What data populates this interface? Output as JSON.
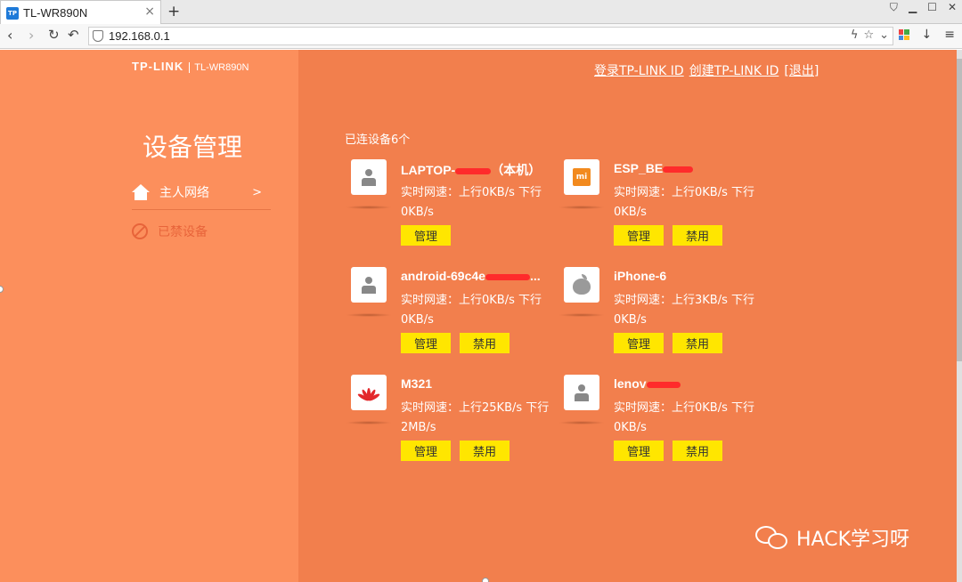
{
  "browser": {
    "tab_title": "TL-WR890N",
    "favicon_text": "TP",
    "tab_close": "×",
    "new_tab": "+",
    "url": "192.168.0.1"
  },
  "header": {
    "logo": "TP-LINK",
    "model": "TL-WR890N",
    "links": [
      "登录TP-LINK ID",
      "创建TP-LINK ID",
      "[退出]"
    ]
  },
  "sidebar": {
    "title": "设备管理",
    "items": [
      {
        "label": "主人网络",
        "chevron": ">"
      },
      {
        "label": "已禁设备"
      }
    ]
  },
  "main": {
    "device_count": "已连设备6个",
    "manage_label": "管理",
    "ban_label": "禁用",
    "devices": [
      {
        "name": "LAPTOP-",
        "name_suffix": "（本机）",
        "speed": "实时网速：上行0KB/s 下行0KB/s",
        "icon": "person-icon"
      },
      {
        "name": "ESP_BE",
        "name_suffix": "",
        "speed": "实时网速：上行0KB/s 下行0KB/s",
        "icon": "xiaomi-icon",
        "icon_text": "mi"
      },
      {
        "name": "android-69c4e",
        "name_suffix": "...",
        "speed": "实时网速：上行0KB/s 下行0KB/s",
        "icon": "person-icon"
      },
      {
        "name": "iPhone-6",
        "name_suffix": "",
        "speed": "实时网速：上行3KB/s 下行0KB/s",
        "icon": "apple-icon"
      },
      {
        "name": "M321",
        "name_suffix": "",
        "speed": "实时网速：上行25KB/s 下行2MB/s",
        "icon": "huawei-icon"
      },
      {
        "name": "lenov",
        "name_suffix": "",
        "speed": "实时网速：上行0KB/s 下行0KB/s",
        "icon": "person-icon"
      }
    ]
  },
  "watermark": "HACK学习呀",
  "colors": {
    "main_bg": "#f27f4d",
    "sidebar_bg": "#fc8f5c",
    "button_bg": "#ffe600",
    "redaction": "#ff2b2b"
  }
}
